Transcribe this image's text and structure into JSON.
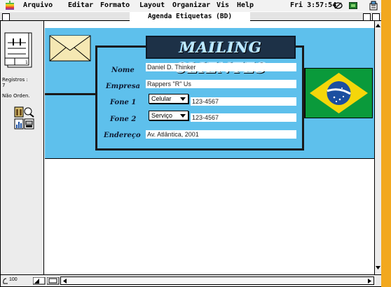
{
  "menubar": {
    "items": [
      "Arquivo",
      "Editar",
      "Formato",
      "Layout",
      "Organizar",
      "Vis",
      "Help"
    ],
    "clock": "Fri 3:57:54"
  },
  "window": {
    "title": "Agenda Etiquetas (BD)"
  },
  "sidebar": {
    "records_label": "Registros :",
    "records_count": "7",
    "sort_status": "Não Orden.",
    "book_page": "1"
  },
  "form": {
    "title": "MAILING CLIENTES",
    "labels": {
      "nome": "Nome",
      "empresa": "Empresa",
      "fone1": "Fone 1",
      "fone2": "Fone 2",
      "endereco": "Endereço"
    },
    "values": {
      "nome": "Daniel D. Thinker",
      "empresa": "Rappers \"R\" Us",
      "fone1_type": "Celular",
      "fone1": "123-4567",
      "fone2_type": "Serviço",
      "fone2": "123-4567",
      "endereco": "Av. Atlântica, 2001"
    }
  },
  "statusbar": {
    "zoom": "100"
  },
  "colors": {
    "layout_bg": "#5ec0ec",
    "title_bg": "#1d3147",
    "flag_green": "#0a9a3b",
    "flag_yellow": "#f5d60a",
    "flag_blue": "#1b4fa0",
    "accent_stripe": "#f2a81f"
  },
  "icons": [
    "apple-icon",
    "help-icon",
    "app-icon",
    "rolodex-book-icon",
    "envelope-icon",
    "brazil-flag-icon",
    "layout-tools-icon",
    "zoom-icon"
  ]
}
